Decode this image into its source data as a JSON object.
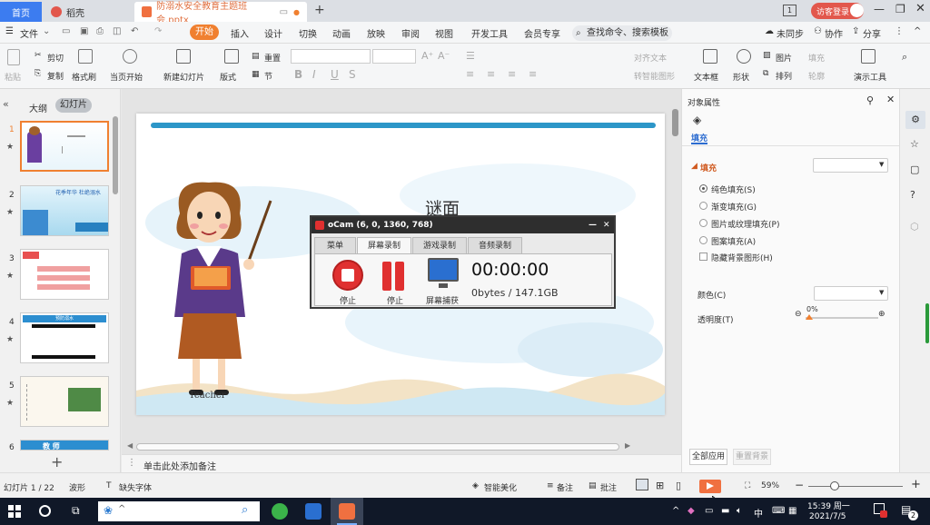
{
  "tabs": {
    "home": "首页",
    "daoke": "稻壳",
    "document": "防溺水安全教育主题班会.pptx"
  },
  "titlebar": {
    "login": "访客登录"
  },
  "menu": {
    "file": "文件",
    "items": [
      "开始",
      "插入",
      "设计",
      "切换",
      "动画",
      "放映",
      "审阅",
      "视图",
      "开发工具",
      "会员专享"
    ],
    "search": "查找命令、搜索模板",
    "sync": "未同步",
    "collab": "协作",
    "share": "分享"
  },
  "ribbon": {
    "paste": "粘贴",
    "cut": "剪切",
    "copy": "复制",
    "format_painter": "格式刷",
    "play_current": "当页开始",
    "new_slide": "新建幻灯片",
    "layout": "版式",
    "section": "节",
    "reset": "重置",
    "text_box": "文本框",
    "shape": "形状",
    "picture": "图片",
    "arrange": "排列",
    "fill": "填充",
    "outline": "轮廓",
    "presenter_tools": "演示工具",
    "convert_to_smart": "转智能图形",
    "align_text": "对齐文本"
  },
  "left_panel": {
    "outline": "大纲",
    "slides": "幻灯片",
    "thumbs": [
      "1",
      "2",
      "3",
      "4",
      "5",
      "6"
    ],
    "thumb2_text": "花季年华 杜绝溺水",
    "thumb4_text": "预防溺水",
    "thumb6_text": "教 师"
  },
  "slide": {
    "title": "谜面",
    "teacher_label": "Teacher"
  },
  "ocam": {
    "title": "oCam (6, 0, 1360, 768)",
    "tabs": [
      "菜单",
      "屏幕录制",
      "游戏录制",
      "音频录制"
    ],
    "btn_record": "停止",
    "btn_pause": "停止",
    "btn_capture": "屏幕捕获",
    "time": "00:00:00",
    "size": "0bytes / 147.1GB"
  },
  "right_panel": {
    "title": "对象属性",
    "tab": "填充",
    "section": "填充",
    "options": [
      "纯色填充(S)",
      "渐变填充(G)",
      "图片或纹理填充(P)",
      "图案填充(A)"
    ],
    "hide_bg": "隐藏背景图形(H)",
    "color_label": "颜色(C)",
    "transparency_label": "透明度(T)",
    "transparency_value": "0%",
    "apply_all": "全部应用",
    "reset_bg": "重置背景"
  },
  "notes": {
    "placeholder": "单击此处添加备注"
  },
  "statusbar": {
    "slide_index": "幻灯片 1 / 22",
    "theme": "波形",
    "missing_font": "缺失字体",
    "smart_beautify": "智能美化",
    "notes": "备注",
    "comments": "批注",
    "zoom": "59%"
  },
  "taskbar": {
    "time": "15:39 周一",
    "date": "2021/7/5",
    "ime": "中",
    "notif_count": "2"
  },
  "colors": {
    "accent": "#f08030",
    "home_tab": "#3c7cf0",
    "record_red": "#e03030"
  }
}
